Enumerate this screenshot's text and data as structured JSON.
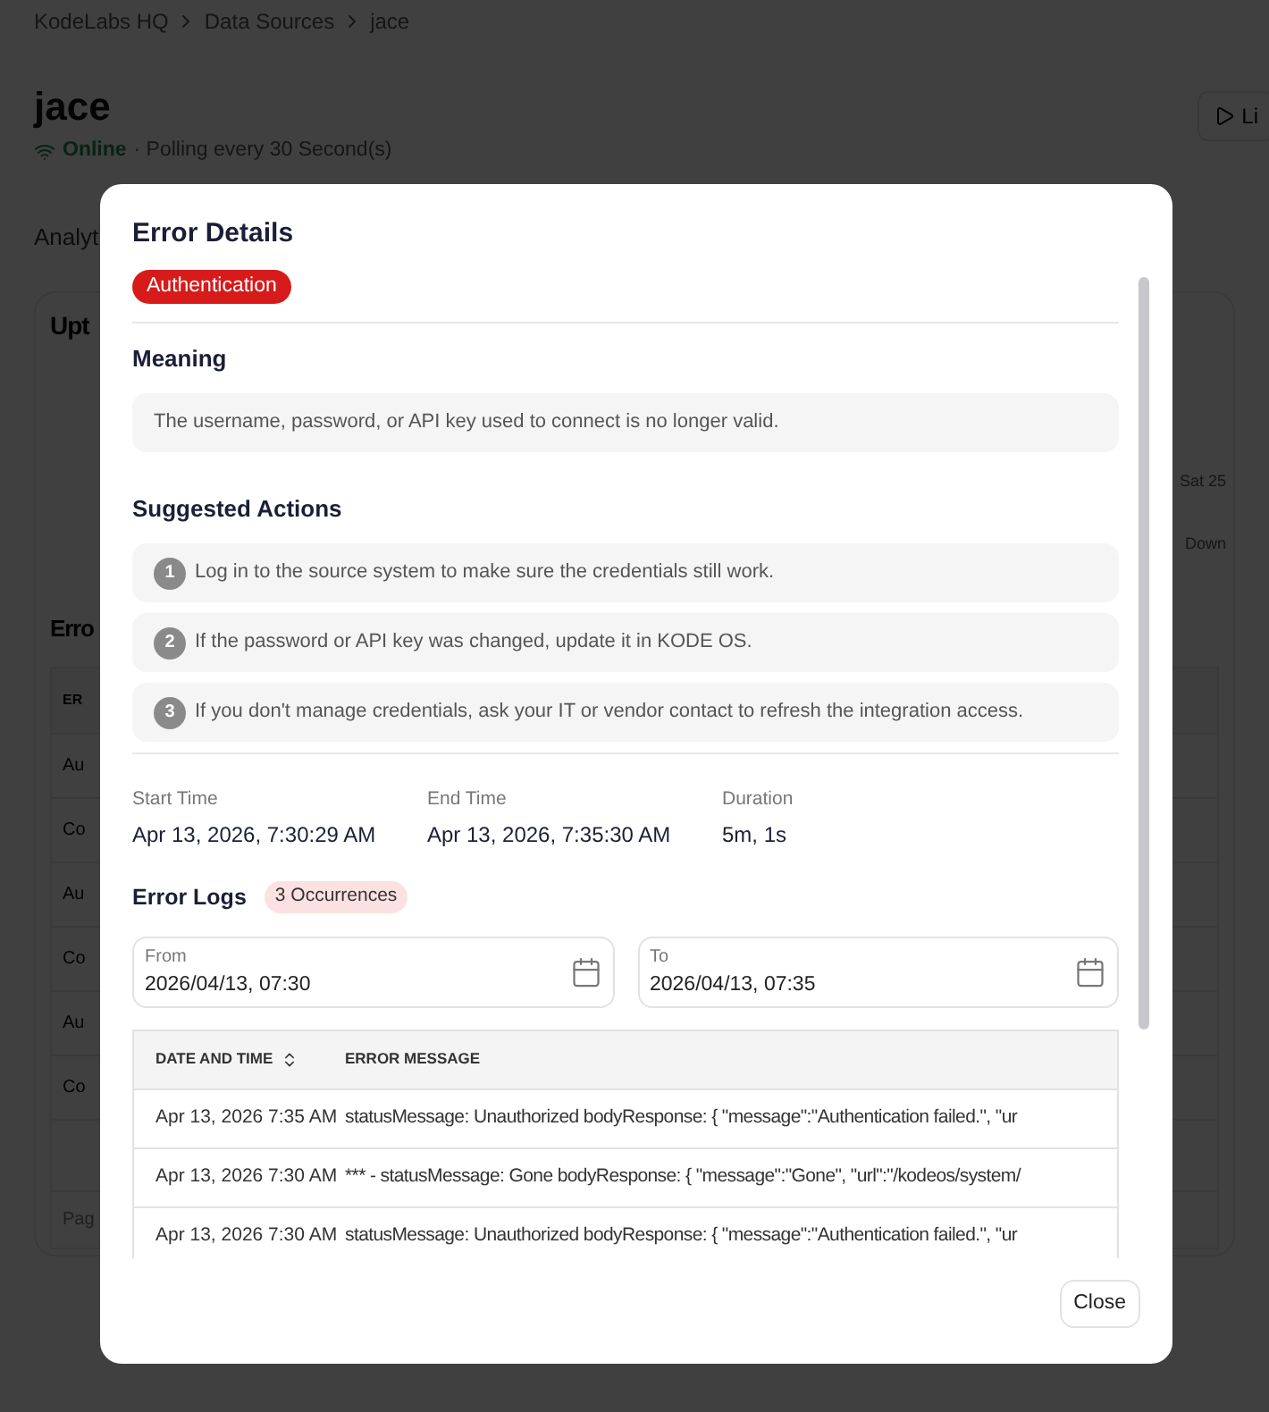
{
  "background": {
    "breadcrumb": [
      "KodeLabs HQ",
      "Data Sources",
      "jace"
    ],
    "title": "jace",
    "status": {
      "label": "Online",
      "online": true
    },
    "polling": "· Polling every 30 Second(s)",
    "live_button": "Li",
    "tab_label": "Analyt",
    "uptime_heading": "Upt",
    "day_label": "Sat 25",
    "down_label": "Down",
    "errors_heading": "Erro",
    "table_header": "ER",
    "table_cells": [
      "Au",
      "Co",
      "Au",
      "Co",
      "Au",
      "Co"
    ],
    "pagination": "Pag"
  },
  "modal": {
    "title": "Error Details",
    "category_badge": "Authentication",
    "meaning": {
      "heading": "Meaning",
      "text": "The username, password, or API key used to connect is no longer valid."
    },
    "suggested_actions": {
      "heading": "Suggested Actions",
      "items": [
        {
          "number": "1",
          "text": "Log in to the source system to make sure the credentials still work."
        },
        {
          "number": "2",
          "text": "If the password or API key was changed, update it in KODE OS."
        },
        {
          "number": "3",
          "text": "If you don't manage credentials, ask your IT or vendor contact to refresh the integration access."
        }
      ]
    },
    "times": [
      {
        "label": "Start Time",
        "value": "Apr 13, 2026, 7:30:29 AM"
      },
      {
        "label": "End Time",
        "value": "Apr 13, 2026, 7:35:30 AM"
      },
      {
        "label": "Duration",
        "value": "5m, 1s"
      }
    ],
    "error_logs": {
      "heading": "Error Logs",
      "count_badge": "3 Occurrences",
      "from": {
        "label": "From",
        "value": "2026/04/13, 07:30"
      },
      "to": {
        "label": "To",
        "value": "2026/04/13, 07:35"
      },
      "table": {
        "columns": [
          "DATE AND TIME",
          "ERROR MESSAGE"
        ],
        "rows": [
          {
            "date": "Apr 13, 2026 7:35 AM",
            "message": "statusMessage: Unauthorized bodyResponse: { \"message\":\"Authentication failed.\", \"ur"
          },
          {
            "date": "Apr 13, 2026 7:30 AM",
            "message": "*** - statusMessage: Gone bodyResponse: { \"message\":\"Gone\", \"url\":\"/kodeos/system/"
          },
          {
            "date": "Apr 13, 2026 7:30 AM",
            "message": "statusMessage: Unauthorized bodyResponse: { \"message\":\"Authentication failed.\", \"ur"
          }
        ]
      }
    },
    "close_button": "Close"
  }
}
